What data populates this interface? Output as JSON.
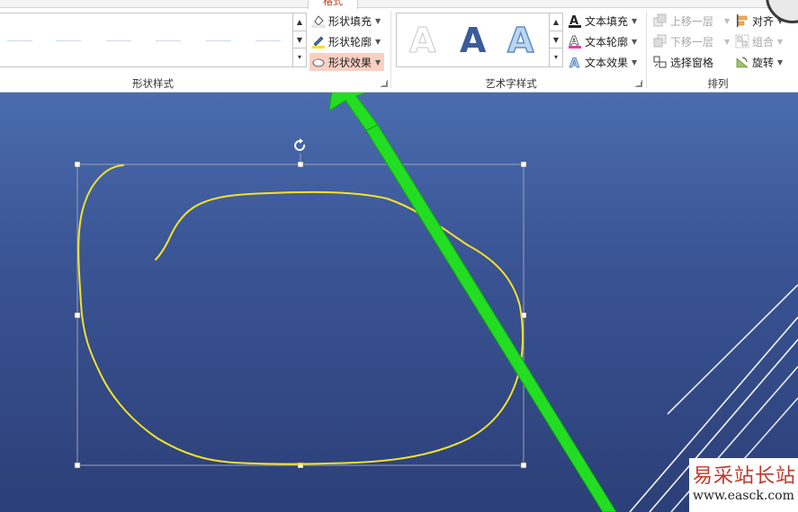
{
  "ribbon": {
    "active_tab": "格式",
    "groups": {
      "shape_styles": {
        "label": "形状样式",
        "fill": "形状填充",
        "outline": "形状轮廓",
        "effects": "形状效果"
      },
      "wordart_styles": {
        "label": "艺术字样式",
        "text_fill": "文本填充",
        "text_outline": "文本轮廓",
        "text_effects": "文本效果",
        "sample_letter": "A"
      },
      "arrange": {
        "label": "排列",
        "bring_forward": "上移一层",
        "send_backward": "下移一层",
        "selection_pane": "选择窗格",
        "align": "对齐",
        "group": "组合",
        "rotate": "旋转"
      }
    }
  },
  "colors": {
    "accent_highlight": "#fbd0c3",
    "annotation_arrow": "#22dd22",
    "drawn_stroke": "#f5e12a",
    "slide_bg": "#3a5494"
  },
  "watermark": {
    "text": "易采站长站",
    "url": "www.easck.com"
  }
}
